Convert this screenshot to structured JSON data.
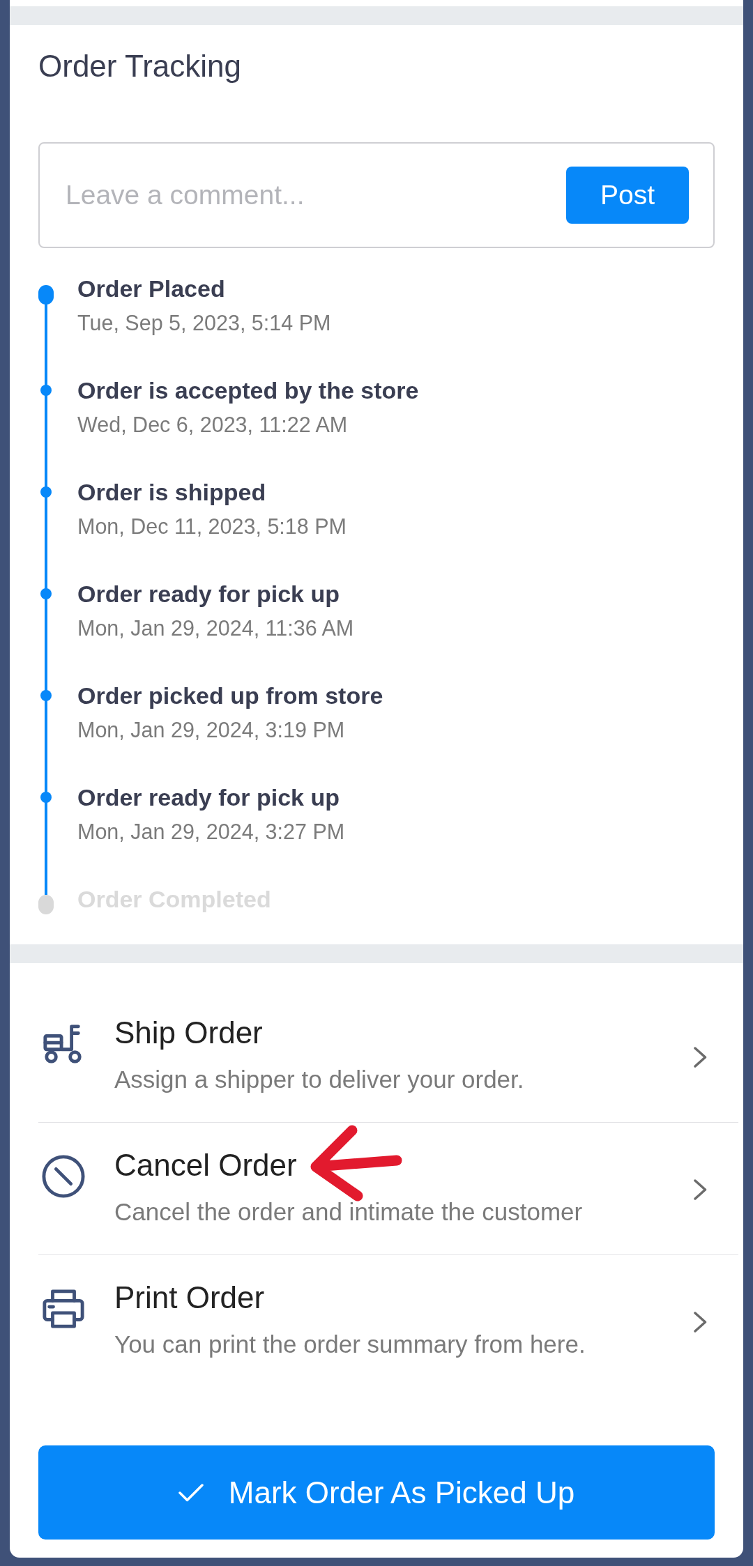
{
  "section_title": "Order Tracking",
  "comment": {
    "placeholder": "Leave a comment...",
    "button": "Post"
  },
  "timeline": [
    {
      "title": "Order Placed",
      "time": "Tue, Sep 5, 2023, 5:14 PM",
      "done": true
    },
    {
      "title": "Order is accepted by the store",
      "time": "Wed, Dec 6, 2023, 11:22 AM",
      "done": true
    },
    {
      "title": "Order is shipped",
      "time": "Mon, Dec 11, 2023, 5:18 PM",
      "done": true
    },
    {
      "title": "Order ready for pick up",
      "time": "Mon, Jan 29, 2024, 11:36 AM",
      "done": true
    },
    {
      "title": "Order picked up from store",
      "time": "Mon, Jan 29, 2024, 3:19 PM",
      "done": true
    },
    {
      "title": "Order ready for pick up",
      "time": "Mon, Jan 29, 2024, 3:27 PM",
      "done": true
    },
    {
      "title": "Order Completed",
      "done": false
    }
  ],
  "actions": [
    {
      "kind": "ship",
      "title": "Ship Order",
      "subtitle": "Assign a shipper to deliver your order.",
      "annotated": false
    },
    {
      "kind": "cancel",
      "title": "Cancel Order",
      "subtitle": "Cancel the order and intimate the customer",
      "annotated": true
    },
    {
      "kind": "print",
      "title": "Print Order",
      "subtitle": "You can print the order summary from here.",
      "annotated": false
    }
  ],
  "primary_button": {
    "label": "Mark Order As Picked Up"
  }
}
